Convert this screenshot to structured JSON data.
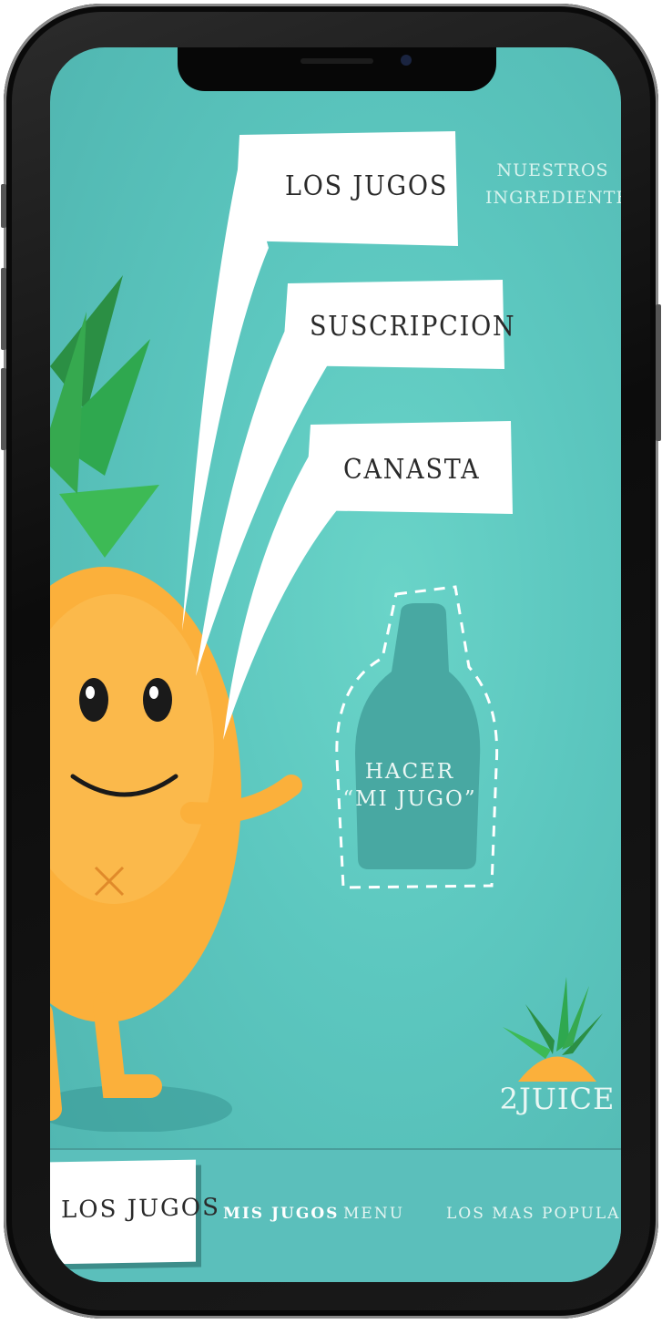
{
  "menu": {
    "bubbles": [
      {
        "label": "LOS JUGOS"
      },
      {
        "label": "SUSCRIPCION"
      },
      {
        "label": "CANASTA"
      }
    ],
    "top_link": {
      "line1": "NUESTROS",
      "line2": "INGREDIENTES"
    }
  },
  "cta": {
    "line1": "HACER",
    "line2": "“MI JUGO”"
  },
  "brand": {
    "name": "2JUICE"
  },
  "nav": {
    "active": "LOS JUGOS",
    "items": [
      "MIS JUGOS",
      "MENU",
      "LOS MAS POPULARES"
    ]
  },
  "colors": {
    "background": "#5cc7bf",
    "bubble": "#ffffff",
    "pineapple": "#fbb03b",
    "leaves": "#2fa84f",
    "bottle": "#48a8a2"
  },
  "icons": {
    "mascot": "pineapple-mascot-icon",
    "bottle": "bottle-icon",
    "logo": "pineapple-logo-icon"
  }
}
